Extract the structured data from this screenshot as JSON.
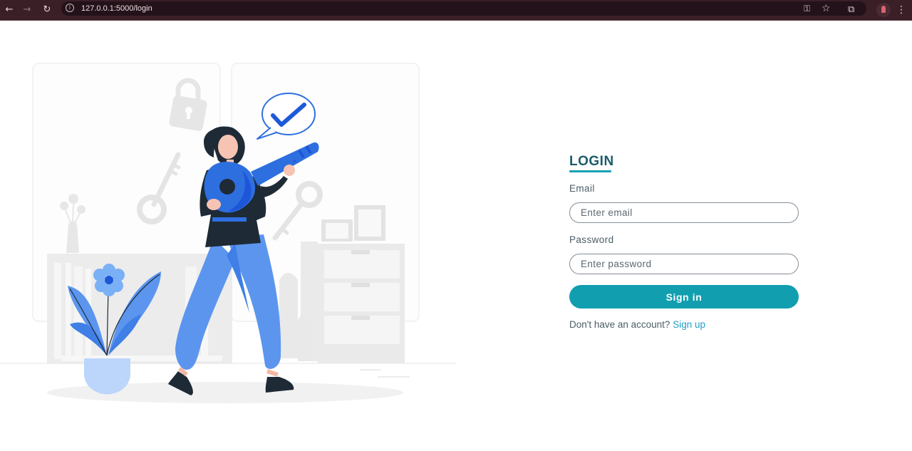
{
  "browser": {
    "url": "127.0.0.1:5000/login",
    "back_icon": "←",
    "forward_icon": "→",
    "reload_icon": "↻",
    "info_icon": "i",
    "key_icon": "⚿",
    "star_icon": "☆",
    "extensions_icon": "⧉",
    "menu_icon": "⋮"
  },
  "login": {
    "title": "LOGIN",
    "email_label": "Email",
    "email_placeholder": "Enter email",
    "email_value": "",
    "password_label": "Password",
    "password_placeholder": "Enter password",
    "password_value": "",
    "submit_label": "Sign in",
    "signup_prompt": "Don't have an account?",
    "signup_link": "Sign up"
  },
  "colors": {
    "accent": "#119fb0",
    "title": "#1c5d6b",
    "link": "#1b9fc9",
    "illustration_blue": "#2e6fe0",
    "illustration_light_blue": "#5b95ee",
    "chrome_bg": "#3a1f27"
  }
}
